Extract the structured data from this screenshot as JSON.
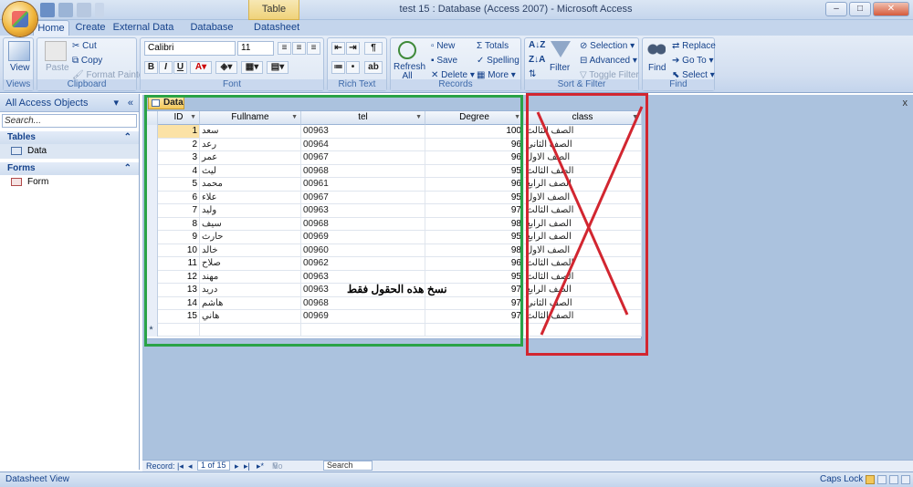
{
  "window": {
    "title": "test 15 : Database (Access 2007) - Microsoft Access",
    "context_tab": "Table Tools",
    "controls": {
      "minimize": "–",
      "maximize": "□",
      "close": "✕"
    }
  },
  "tabs": [
    "Home",
    "Create",
    "External Data",
    "Database Tools",
    "Datasheet"
  ],
  "ribbon": {
    "views": {
      "label": "Views",
      "view": "View"
    },
    "clipboard": {
      "label": "Clipboard",
      "paste": "Paste",
      "cut": "Cut",
      "copy": "Copy",
      "format_painter": "Format Painter"
    },
    "font": {
      "label": "Font",
      "font_name": "Calibri",
      "font_size": "11"
    },
    "rich_text": {
      "label": "Rich Text"
    },
    "records": {
      "label": "Records",
      "refresh": "Refresh All",
      "new": "New",
      "save": "Save",
      "delete": "Delete",
      "totals": "Totals",
      "spelling": "Spelling",
      "more": "More"
    },
    "sort_filter": {
      "label": "Sort & Filter",
      "filter": "Filter",
      "selection": "Selection",
      "advanced": "Advanced",
      "toggle_filter": "Toggle Filter"
    },
    "find": {
      "label": "Find",
      "find": "Find",
      "replace": "Replace",
      "goto": "Go To",
      "select": "Select"
    }
  },
  "nav_pane": {
    "header": "All Access Objects",
    "search_placeholder": "Search...",
    "groups": [
      {
        "name": "Tables",
        "items": [
          "Data"
        ]
      },
      {
        "name": "Forms",
        "items": [
          "Form"
        ]
      }
    ]
  },
  "document": {
    "tab_label": "Data",
    "close": "x",
    "columns": [
      "ID",
      "Fullname",
      "tel",
      "Degree",
      "class"
    ],
    "rows": [
      {
        "id": "1",
        "fullname": "سعد",
        "tel": "00963",
        "degree": "100",
        "class": "الصف الثالث"
      },
      {
        "id": "2",
        "fullname": "رعد",
        "tel": "00964",
        "degree": "96",
        "class": "الصف الثاني"
      },
      {
        "id": "3",
        "fullname": "عمر",
        "tel": "00967",
        "degree": "96",
        "class": "الصف الاول"
      },
      {
        "id": "4",
        "fullname": "ليث",
        "tel": "00968",
        "degree": "95",
        "class": "الصف الثالث"
      },
      {
        "id": "5",
        "fullname": "محمد",
        "tel": "00961",
        "degree": "96",
        "class": "الصف الرابع"
      },
      {
        "id": "6",
        "fullname": "علاء",
        "tel": "00967",
        "degree": "95",
        "class": "الصف الاول"
      },
      {
        "id": "7",
        "fullname": "وليد",
        "tel": "00963",
        "degree": "97",
        "class": "الصف الثالث"
      },
      {
        "id": "8",
        "fullname": "سيف",
        "tel": "00968",
        "degree": "98",
        "class": "الصف الرابع"
      },
      {
        "id": "9",
        "fullname": "حارث",
        "tel": "00969",
        "degree": "95",
        "class": "الصف الرابع"
      },
      {
        "id": "10",
        "fullname": "خالد",
        "tel": "00960",
        "degree": "98",
        "class": "الصف الاول"
      },
      {
        "id": "11",
        "fullname": "صلاح",
        "tel": "00962",
        "degree": "96",
        "class": "الصف الثالث"
      },
      {
        "id": "12",
        "fullname": "مهند",
        "tel": "00963",
        "degree": "95",
        "class": "الصف الثالث"
      },
      {
        "id": "13",
        "fullname": "دريد",
        "tel": "00963",
        "degree": "97",
        "class": "الصف الرابع"
      },
      {
        "id": "14",
        "fullname": "هاشم",
        "tel": "00968",
        "degree": "97",
        "class": "الصف الثاني"
      },
      {
        "id": "15",
        "fullname": "هاني",
        "tel": "00969",
        "degree": "97",
        "class": "الصف الثالث"
      }
    ],
    "new_row_marker": "*",
    "annotation": "نسخ هذه الحقول فقط"
  },
  "record_nav": {
    "label": "Record:",
    "position": "1 of 15",
    "filter": "No Filter",
    "search": "Search"
  },
  "status_bar": {
    "left": "Datasheet View",
    "right": "Caps Lock"
  },
  "colors": {
    "green_box": "#2aa347",
    "red_box": "#d22630",
    "ribbon_bg": "#dbe6f4"
  }
}
